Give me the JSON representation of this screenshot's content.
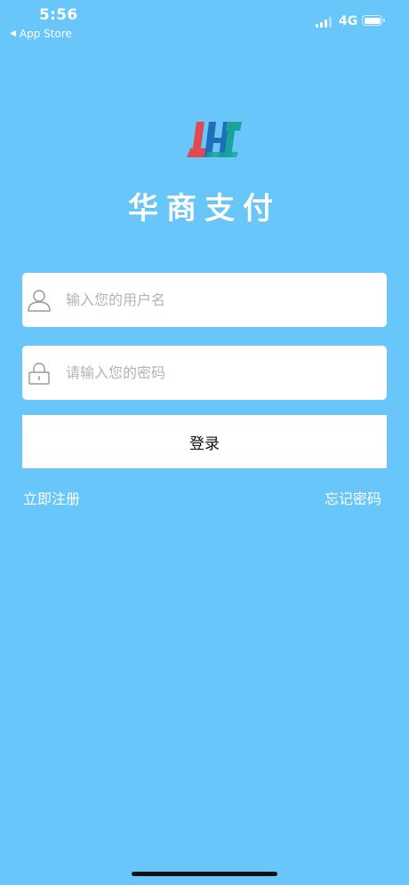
{
  "status_bar": {
    "time": "5:56",
    "back_app": "App Store",
    "network": "4G"
  },
  "app": {
    "name": "华商支付"
  },
  "login_form": {
    "username_placeholder": "输入您的用户名",
    "password_placeholder": "请输入您的密码",
    "login_label": "登录",
    "register_label": "立即注册",
    "forgot_label": "忘记密码"
  },
  "colors": {
    "background": "#68c6fb",
    "logo_red": "#e04a4f",
    "logo_blue": "#1f6fb8",
    "logo_teal": "#1aa39a"
  },
  "icons": {
    "username": "user-icon",
    "password": "lock-icon",
    "back": "back-arrow-icon",
    "signal": "signal-icon",
    "battery": "battery-icon"
  }
}
